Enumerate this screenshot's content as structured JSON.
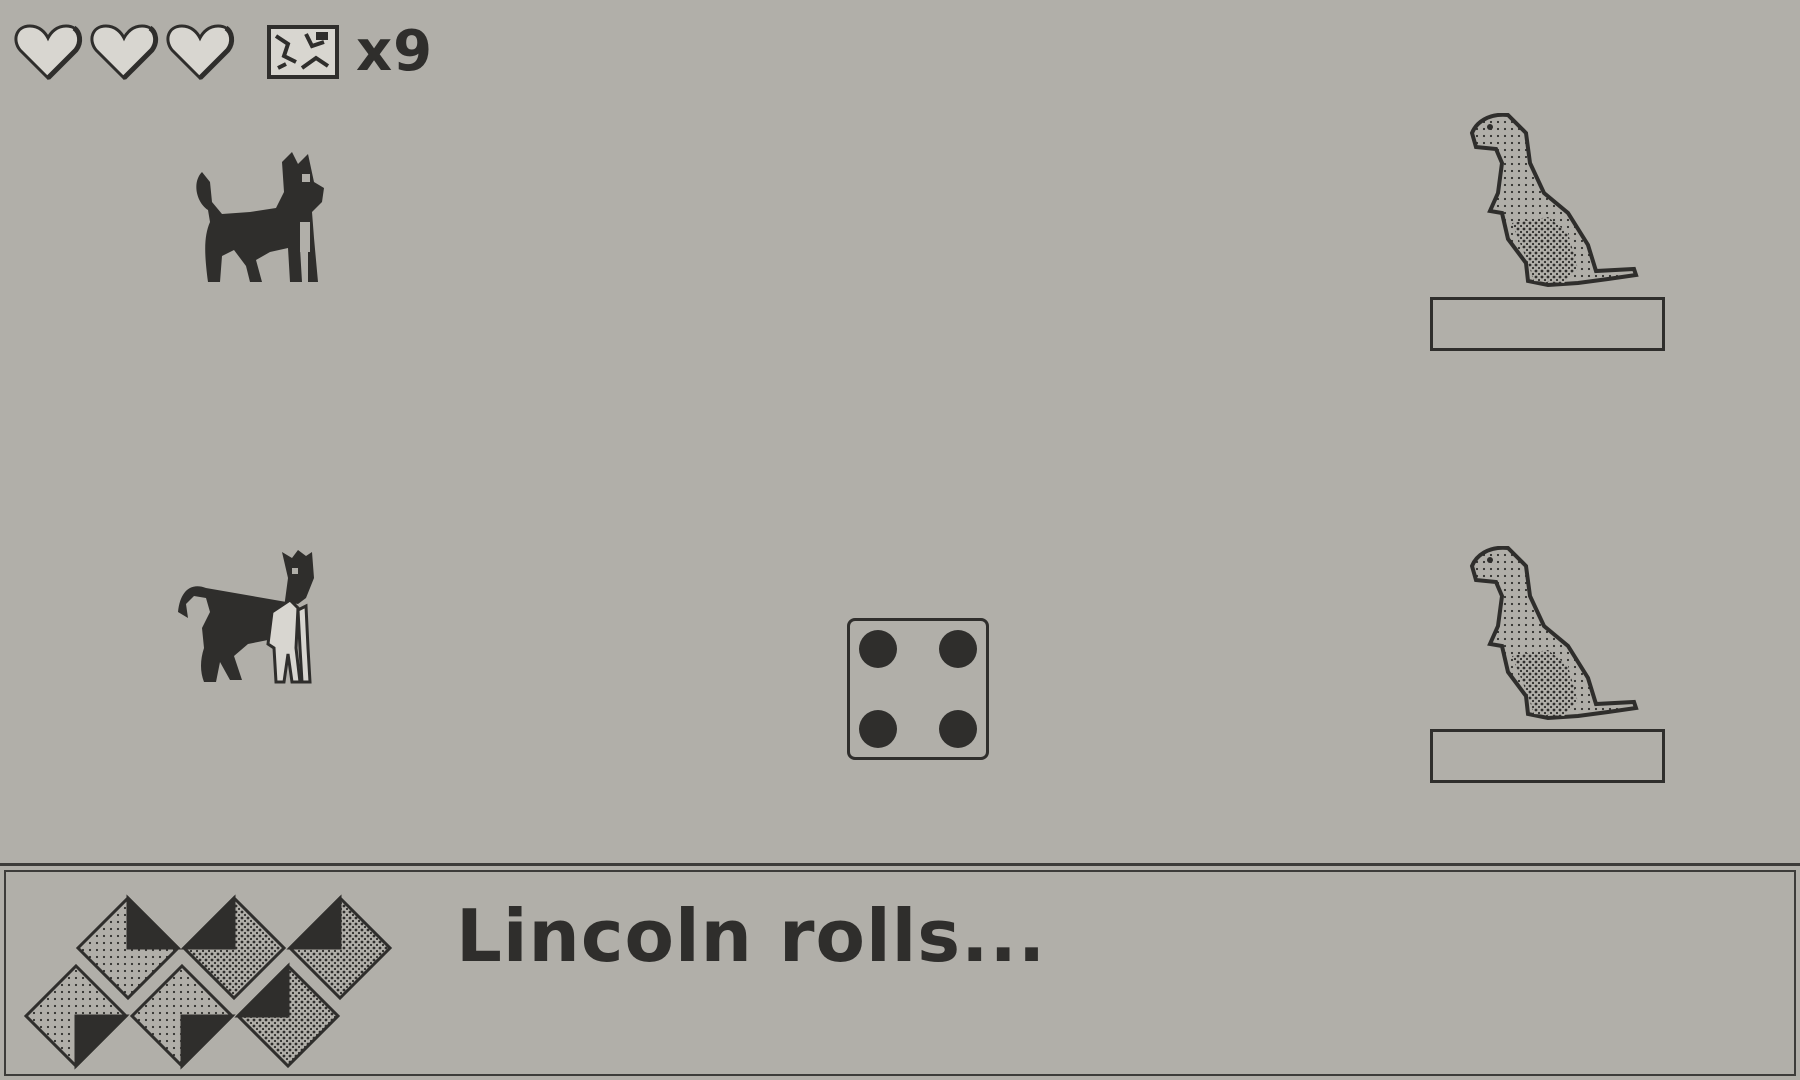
{
  "hud": {
    "hearts": 3,
    "item_icon": "map-icon",
    "item_count": "x9"
  },
  "players": [
    {
      "role": "player",
      "icon": "black-dog-icon"
    },
    {
      "role": "player",
      "icon": "spotted-dog-icon"
    }
  ],
  "opponents": [
    {
      "icon": "prairie-dog-icon",
      "hp_bar": ""
    },
    {
      "icon": "prairie-dog-icon",
      "hp_bar": ""
    }
  ],
  "die": {
    "value": 4
  },
  "dialog": {
    "text": "Lincoln rolls...",
    "portrait_icon": "diamond-pattern-portrait-icon"
  },
  "colors": {
    "background": "#b1afa9",
    "ink": "#2f2e2c"
  }
}
